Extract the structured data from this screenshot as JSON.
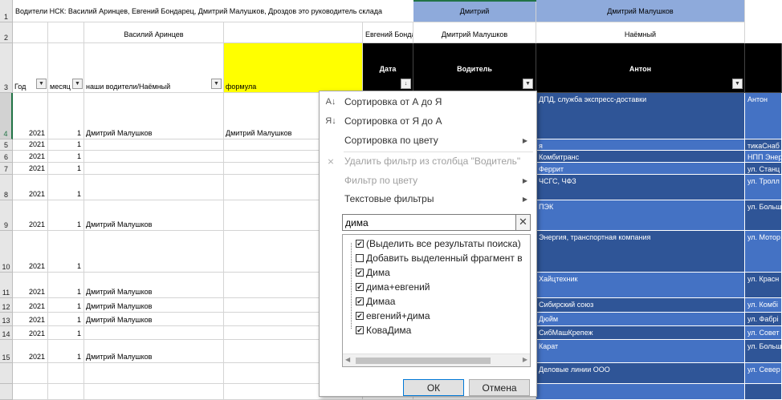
{
  "header": {
    "row1_title": "Водители НСК: Василий Аринцев, Евгений Бондарец, Дмитрий Малушков, Дроздов это руководитель склада",
    "row1_dmitriy": "Дмитрий",
    "row1_dmitriy_malushkov": "Дмитрий Малушков",
    "row2_vasiliy": "Василий Аринцев",
    "row2_evgeniy": "Евгений Бонда",
    "row2_dmitriy_malushkov": "Дмитрий Малушков",
    "row2_naemny": "Наёмный",
    "col_year": "Год",
    "col_month": "месяц",
    "col_drivers": "наши водители/Наёмный",
    "col_formula": "формула",
    "col_date": "Дата",
    "col_driver": "Водитель",
    "col_anton": "Антон"
  },
  "rows": [
    {
      "num": "1"
    },
    {
      "num": "2"
    },
    {
      "num": "3"
    },
    {
      "num": "4",
      "year": "2021",
      "month": "1",
      "driver": "Дмитрий Малушков",
      "formula": "Дмитрий Малушков",
      "company": "ДПД, служба экспресс-доставки",
      "extra": "Антон"
    },
    {
      "num": "5",
      "year": "2021",
      "month": "1",
      "driver": "",
      "formula": "",
      "company": "я",
      "extra": "тикаСнаб"
    },
    {
      "num": "6",
      "year": "2021",
      "month": "1",
      "driver": "",
      "formula": "",
      "company": "Комбитранс",
      "extra": "НПП Энер"
    },
    {
      "num": "7",
      "year": "2021",
      "month": "1",
      "driver": "",
      "formula": "",
      "company": "Феррит",
      "extra": "ул. Станц"
    },
    {
      "num": "8",
      "year": "2021",
      "month": "1",
      "driver": "",
      "formula": "",
      "company": "ЧСГС, ЧФЗ",
      "extra": "ул. Тролл"
    },
    {
      "num": "9",
      "year": "2021",
      "month": "1",
      "driver": "Дмитрий Малушков",
      "formula": "",
      "company": "ПЭК",
      "extra": "ул. Больш"
    },
    {
      "num": "10",
      "year": "2021",
      "month": "1",
      "driver": "",
      "formula": "",
      "company": "Энергия, транспортная компания",
      "extra": "ул. Мотор"
    },
    {
      "num": "11",
      "year": "2021",
      "month": "1",
      "driver": "Дмитрий Малушков",
      "formula": "",
      "company": "Хайцтехник",
      "extra": "ул. Красн"
    },
    {
      "num": "12",
      "year": "2021",
      "month": "1",
      "driver": "Дмитрий Малушков",
      "formula": "",
      "company": "Сибирский союз",
      "extra": "ул. Комбі"
    },
    {
      "num": "13",
      "year": "2021",
      "month": "1",
      "driver": "Дмитрий Малушков",
      "formula": "",
      "company": "Дюйм",
      "extra": "ул. Фабрі"
    },
    {
      "num": "14",
      "year": "2021",
      "month": "1",
      "driver": "",
      "formula": "",
      "company": "СибМашКрепеж",
      "extra": "ул. Совет"
    },
    {
      "num": "15",
      "year": "2021",
      "month": "1",
      "driver": "Дмитрий Малушков",
      "formula": "",
      "company": "Карат",
      "extra": "ул. Больш"
    },
    {
      "num": "",
      "year": "",
      "month": "",
      "driver": "",
      "formula": "",
      "company": "Деловые линии ООО",
      "extra": "ул. Север"
    }
  ],
  "filter_menu": {
    "sort_az": "Сортировка от А до Я",
    "sort_za": "Сортировка от Я до А",
    "sort_color": "Сортировка по цвету",
    "clear_filter": "Удалить фильтр из столбца \"Водитель\"",
    "filter_color": "Фильтр по цвету",
    "text_filters": "Текстовые фильтры",
    "search_value": "дима",
    "items": [
      {
        "label": "(Выделить все результаты поиска)",
        "checked": true
      },
      {
        "label": "Добавить выделенный фрагмент в",
        "checked": false
      },
      {
        "label": "Дима",
        "checked": true
      },
      {
        "label": "дима+евгений",
        "checked": true
      },
      {
        "label": "Димаа",
        "checked": true
      },
      {
        "label": "евгений+дима",
        "checked": true
      },
      {
        "label": "КоваДима",
        "checked": true
      }
    ],
    "ok_label": "ОК",
    "cancel_label": "Отмена"
  },
  "colors": {
    "yellow": "#ffff00",
    "black": "#000000",
    "light_blue": "#8eaadb",
    "dark_blue": "#2f5597",
    "mid_blue": "#4472c4"
  }
}
